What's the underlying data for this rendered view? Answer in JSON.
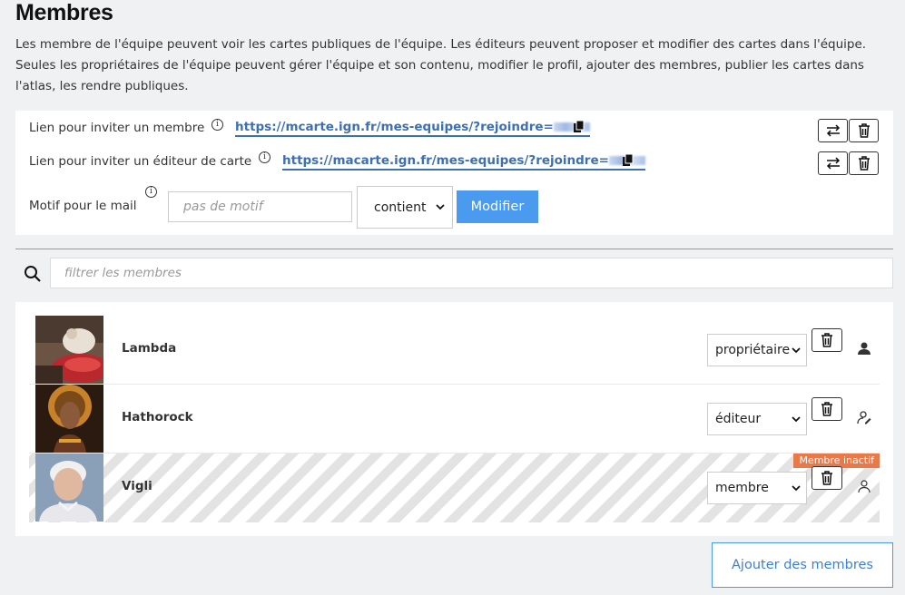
{
  "title": "Membres",
  "description": "Les membre de l'équipe peuvent voir les cartes publiques de l'équipe. Les éditeurs peuvent proposer et modifier des cartes dans l'équipe. Seules les propriétaires de l'équipe peuvent gérer l'équipe et son contenu, modifier le profil, ajouter des membres, publier les cartes dans l'atlas, les rendre publiques.",
  "invite": {
    "member_label": "Lien pour inviter un membre",
    "member_link": "https://mcarte.ign.fr/mes-equipes/?rejoindre=",
    "editor_label": "Lien pour inviter un éditeur de carte",
    "editor_link": "https://macarte.ign.fr/mes-equipes/?rejoindre=",
    "motif_label": "Motif pour le mail",
    "motif_placeholder": "pas de motif",
    "motif_select_value": "contient",
    "modify_label": "Modifier"
  },
  "filter": {
    "placeholder": "filtrer les membres"
  },
  "members": [
    {
      "name": "Lambda",
      "role": "propriétaire",
      "role_icon": "owner-icon",
      "inactive": false
    },
    {
      "name": "Hathorock",
      "role": "éditeur",
      "role_icon": "editor-icon",
      "inactive": false
    },
    {
      "name": "Vigli",
      "role": "membre",
      "role_icon": "member-icon",
      "inactive": true,
      "badge": "Membre inactif"
    }
  ],
  "add_members_label": "Ajouter des membres",
  "colors": {
    "accent": "#4a9bf0",
    "link": "#3d6fb4",
    "badge": "#e8794a"
  }
}
